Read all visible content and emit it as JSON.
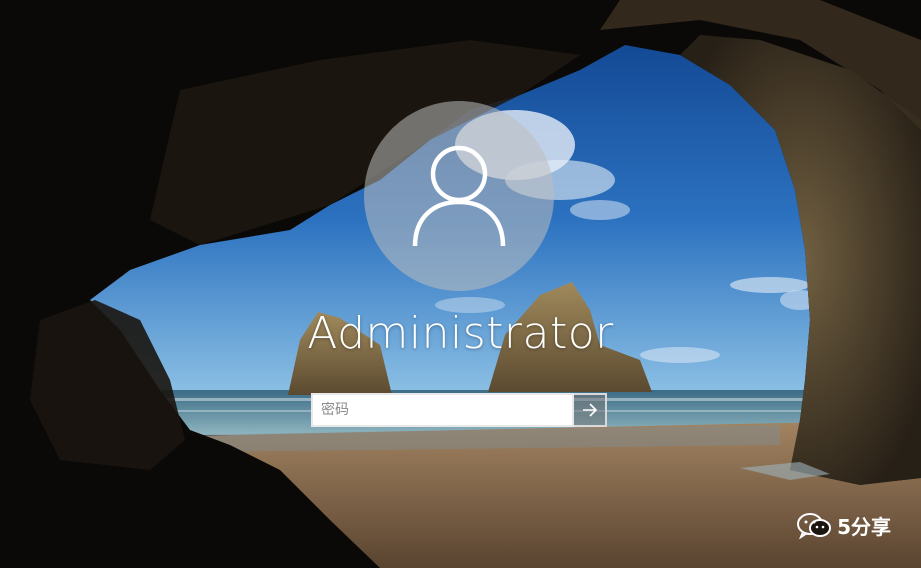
{
  "login": {
    "username": "Administrator",
    "password_placeholder": "密码",
    "password_value": ""
  },
  "icons": {
    "avatar": "user-silhouette-icon",
    "submit": "arrow-right-icon",
    "watermark": "wechat-icon"
  },
  "watermark": {
    "text": "5分享"
  },
  "colors": {
    "text": "#ffffff",
    "input_background": "#ffffff",
    "avatar_circle": "#bebebe"
  }
}
